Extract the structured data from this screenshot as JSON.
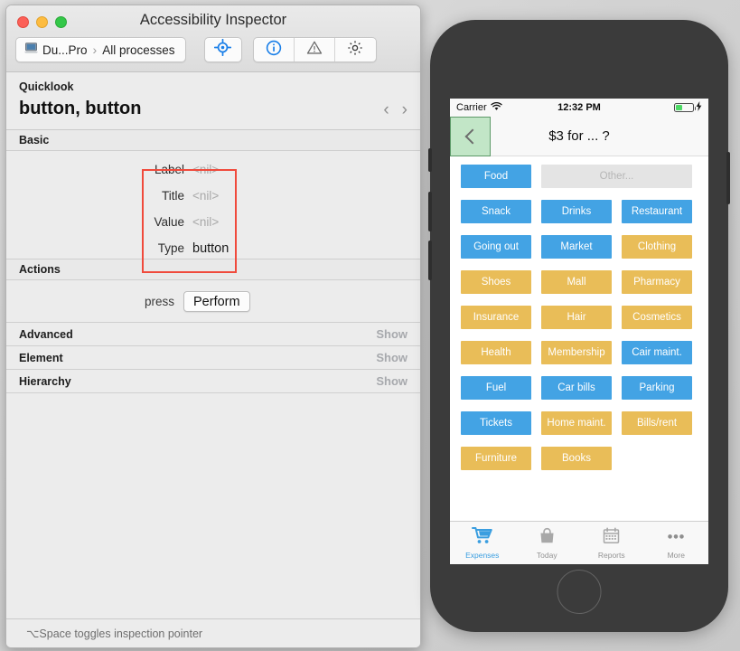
{
  "inspector": {
    "window_title": "Accessibility Inspector",
    "traffic_lights": [
      "close-red",
      "minimize-yellow",
      "zoom-green"
    ],
    "breadcrumb": {
      "device_icon": "laptop-icon",
      "device": "Du...Pro",
      "separator": "›",
      "target": "All processes"
    },
    "toolbar": {
      "pointer_icon": "crosshair-target-icon",
      "info_icon": "info-circle-icon",
      "warning_icon": "warning-triangle-icon",
      "settings_icon": "gear-icon",
      "accent_color": "#1a7fe8"
    },
    "quicklook": {
      "section_label": "Quicklook",
      "title": "button, button",
      "prev_label": "‹",
      "next_label": "›"
    },
    "basic": {
      "header": "Basic",
      "highlight_color": "#f04a3c",
      "fields": [
        {
          "key": "Label",
          "value": "<nil>",
          "nil": true
        },
        {
          "key": "Title",
          "value": "<nil>",
          "nil": true
        },
        {
          "key": "Value",
          "value": "<nil>",
          "nil": true
        },
        {
          "key": "Type",
          "value": "button",
          "nil": false
        }
      ]
    },
    "actions": {
      "header": "Actions",
      "action_name": "press",
      "perform_label": "Perform"
    },
    "collapsed_sections": [
      {
        "name": "Advanced",
        "show_label": "Show"
      },
      {
        "name": "Element",
        "show_label": "Show"
      },
      {
        "name": "Hierarchy",
        "show_label": "Show"
      }
    ],
    "status_text": "⌥Space toggles inspection pointer"
  },
  "simulator": {
    "status_bar": {
      "carrier": "Carrier",
      "wifi_icon": "wifi-icon",
      "time": "12:32 PM",
      "battery_icon": "battery-icon",
      "charging_icon": "lightning-bolt-icon"
    },
    "navbar": {
      "back_icon": "chevron-left-icon",
      "title": "$3 for ... ?",
      "selection_color": "#78cd82"
    },
    "colors": {
      "blue": "#43a3e4",
      "gold": "#e9bd58",
      "disabled": "#e4e4e4"
    },
    "grid_rows": [
      [
        {
          "label": "Food",
          "style": "blue"
        },
        {
          "label": "Other...",
          "style": "other"
        }
      ],
      [
        {
          "label": "Snack",
          "style": "blue"
        },
        {
          "label": "Drinks",
          "style": "blue"
        },
        {
          "label": "Restaurant",
          "style": "blue"
        }
      ],
      [
        {
          "label": "Going out",
          "style": "blue"
        },
        {
          "label": "Market",
          "style": "blue"
        },
        {
          "label": "Clothing",
          "style": "gold"
        }
      ],
      [
        {
          "label": "Shoes",
          "style": "gold"
        },
        {
          "label": "Mall",
          "style": "gold"
        },
        {
          "label": "Pharmacy",
          "style": "gold"
        }
      ],
      [
        {
          "label": "Insurance",
          "style": "gold"
        },
        {
          "label": "Hair",
          "style": "gold"
        },
        {
          "label": "Cosmetics",
          "style": "gold"
        }
      ],
      [
        {
          "label": "Health",
          "style": "gold"
        },
        {
          "label": "Membership",
          "style": "gold"
        },
        {
          "label": "Cair maint.",
          "style": "blue"
        }
      ],
      [
        {
          "label": "Fuel",
          "style": "blue"
        },
        {
          "label": "Car bills",
          "style": "blue"
        },
        {
          "label": "Parking",
          "style": "blue"
        }
      ],
      [
        {
          "label": "Tickets",
          "style": "blue"
        },
        {
          "label": "Home maint.",
          "style": "gold"
        },
        {
          "label": "Bills/rent",
          "style": "gold"
        }
      ],
      [
        {
          "label": "Furniture",
          "style": "gold"
        },
        {
          "label": "Books",
          "style": "gold"
        }
      ]
    ],
    "tabs": [
      {
        "label": "Expenses",
        "icon": "shopping-cart-icon",
        "active": true
      },
      {
        "label": "Today",
        "icon": "bag-icon",
        "active": false
      },
      {
        "label": "Reports",
        "icon": "calendar-icon",
        "active": false
      },
      {
        "label": "More",
        "icon": "ellipsis-icon",
        "active": false
      }
    ],
    "home_button": "home-button"
  }
}
